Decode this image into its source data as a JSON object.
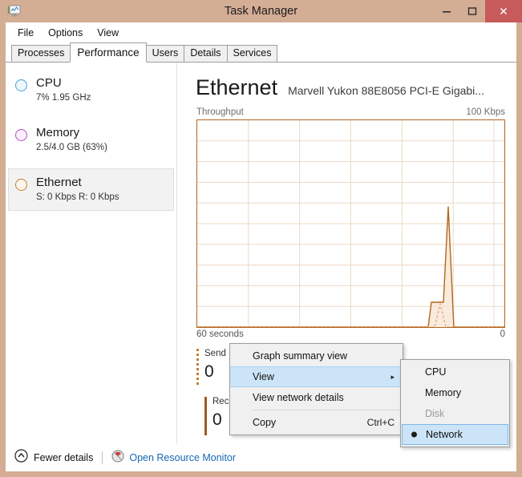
{
  "window": {
    "title": "Task Manager",
    "icon": "task-manager-icon",
    "minimize_label": "–",
    "maximize_label": "☐",
    "close_label": "✕",
    "titlebar_color": "#d4ad95",
    "close_button_color": "#c75a5a"
  },
  "menubar": {
    "items": [
      {
        "label": "File"
      },
      {
        "label": "Options"
      },
      {
        "label": "View"
      }
    ]
  },
  "tabs": [
    {
      "label": "Processes",
      "active": false
    },
    {
      "label": "Performance",
      "active": true
    },
    {
      "label": "Users",
      "active": false
    },
    {
      "label": "Details",
      "active": false
    },
    {
      "label": "Services",
      "active": false
    }
  ],
  "sidebar": {
    "items": [
      {
        "name": "CPU",
        "title": "CPU",
        "subtitle": "7%  1.95 GHz",
        "color": "#4a9fd8",
        "selected": false
      },
      {
        "name": "Memory",
        "title": "Memory",
        "subtitle": "2.5/4.0 GB (63%)",
        "color": "#b84fc9",
        "selected": false
      },
      {
        "name": "Ethernet",
        "title": "Ethernet",
        "subtitle": "S: 0 Kbps R: 0 Kbps",
        "color": "#c87d32",
        "selected": true
      }
    ]
  },
  "main": {
    "title": "Ethernet",
    "subtitle": "Marvell Yukon 88E8056 PCI-E Gigabi...",
    "graph_caption_left": "Throughput",
    "graph_caption_right": "100 Kbps",
    "axis_left": "60 seconds",
    "axis_right": "0",
    "graph_color": "#b5651d",
    "grid_color": "#e8d5c0"
  },
  "stats": [
    {
      "label": "Send",
      "value": "0",
      "style": "dotted"
    },
    {
      "label": "Receive",
      "value": "0",
      "style": "solid"
    }
  ],
  "chart_data": {
    "type": "area",
    "title": "Throughput",
    "xlabel": "60 seconds",
    "ylabel": "Kbps",
    "ylim": [
      0,
      100
    ],
    "xlim": [
      60,
      0
    ],
    "grid": true,
    "legend": "none",
    "x_axis_labels": [
      "60 seconds",
      "0"
    ],
    "y_axis_max_label": "100 Kbps",
    "grid_columns": 6,
    "grid_rows": 10,
    "series": [
      {
        "name": "Send",
        "style": "solid",
        "color": "#b5651d",
        "points": [
          [
            60,
            0
          ],
          [
            12.5,
            0
          ],
          [
            11.0,
            0
          ],
          [
            10.2,
            12
          ],
          [
            8.6,
            12
          ],
          [
            7.6,
            58
          ],
          [
            6.4,
            0
          ],
          [
            5.0,
            0
          ],
          [
            0,
            0
          ]
        ]
      },
      {
        "name": "Receive",
        "style": "dashed",
        "color": "#e09a6a",
        "points": [
          [
            60,
            0
          ],
          [
            11.0,
            0
          ],
          [
            9.6,
            0
          ],
          [
            8.2,
            11
          ],
          [
            6.9,
            0
          ],
          [
            0,
            0
          ]
        ]
      }
    ]
  },
  "context_menu": {
    "items": [
      {
        "label": "Graph summary view",
        "type": "item",
        "highlight": false
      },
      {
        "label": "View",
        "type": "submenu",
        "highlight": true,
        "arrow": "▸"
      },
      {
        "label": "View network details",
        "type": "item",
        "highlight": false
      },
      {
        "label": "separator",
        "type": "separator"
      },
      {
        "label": "Copy",
        "type": "item",
        "accel": "Ctrl+C",
        "highlight": false
      }
    ],
    "submenu": {
      "items": [
        {
          "label": "CPU",
          "disabled": false,
          "checked": false
        },
        {
          "label": "Memory",
          "disabled": false,
          "checked": false
        },
        {
          "label": "Disk",
          "disabled": true,
          "checked": false
        },
        {
          "label": "Network",
          "disabled": false,
          "checked": true
        }
      ]
    }
  },
  "footer": {
    "fewer_details": "Fewer details",
    "resource_monitor": "Open Resource Monitor",
    "link_color": "#1767b5"
  }
}
